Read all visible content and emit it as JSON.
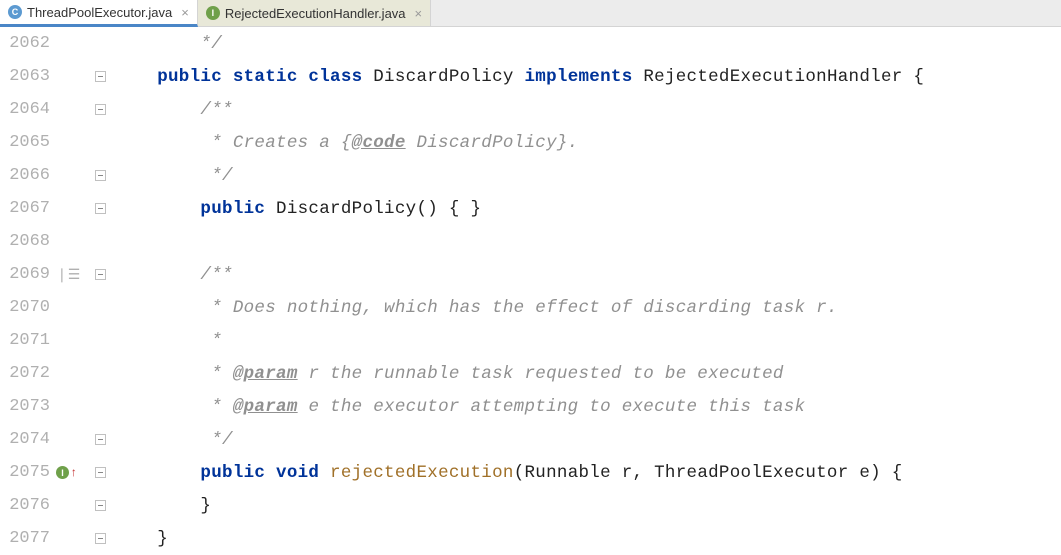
{
  "tabs": [
    {
      "label": "ThreadPoolExecutor.java",
      "icon_kind": "class",
      "icon_letter": "C",
      "active": true
    },
    {
      "label": "RejectedExecutionHandler.java",
      "icon_kind": "iface",
      "icon_letter": "I",
      "active": false
    }
  ],
  "lines": [
    {
      "no": "2062",
      "marker": "",
      "fold": "line",
      "tokens": [
        {
          "cls": "comment",
          "txt": "        */"
        }
      ]
    },
    {
      "no": "2063",
      "marker": "",
      "fold": "handle",
      "tokens": [
        {
          "cls": "kw",
          "txt": "    public static class "
        },
        {
          "cls": "plain",
          "txt": "DiscardPolicy "
        },
        {
          "cls": "kw",
          "txt": "implements "
        },
        {
          "cls": "plain",
          "txt": "RejectedExecutionHandler {"
        }
      ]
    },
    {
      "no": "2064",
      "marker": "",
      "fold": "handle",
      "tokens": [
        {
          "cls": "comment",
          "txt": "        /**"
        }
      ]
    },
    {
      "no": "2065",
      "marker": "",
      "fold": "line",
      "tokens": [
        {
          "cls": "comment",
          "txt": "         * Creates a {"
        },
        {
          "cls": "doctag",
          "txt": "@code"
        },
        {
          "cls": "comment",
          "txt": " DiscardPolicy}."
        }
      ]
    },
    {
      "no": "2066",
      "marker": "",
      "fold": "handle",
      "tokens": [
        {
          "cls": "comment",
          "txt": "         */"
        }
      ]
    },
    {
      "no": "2067",
      "marker": "",
      "fold": "handle",
      "tokens": [
        {
          "cls": "kw",
          "txt": "        public "
        },
        {
          "cls": "plain",
          "txt": "DiscardPolicy() { }"
        }
      ]
    },
    {
      "no": "2068",
      "marker": "",
      "fold": "line",
      "tokens": [
        {
          "cls": "plain",
          "txt": ""
        }
      ]
    },
    {
      "no": "2069",
      "marker": "blockcomment",
      "fold": "handle",
      "tokens": [
        {
          "cls": "comment",
          "txt": "        /**"
        }
      ]
    },
    {
      "no": "2070",
      "marker": "",
      "fold": "line",
      "tokens": [
        {
          "cls": "comment",
          "txt": "         * Does nothing, which has the effect of discarding task r."
        }
      ]
    },
    {
      "no": "2071",
      "marker": "",
      "fold": "line",
      "tokens": [
        {
          "cls": "comment",
          "txt": "         *"
        }
      ]
    },
    {
      "no": "2072",
      "marker": "",
      "fold": "line",
      "tokens": [
        {
          "cls": "comment",
          "txt": "         * "
        },
        {
          "cls": "doctag",
          "txt": "@param"
        },
        {
          "cls": "comment",
          "txt": " r the runnable task requested to be executed"
        }
      ]
    },
    {
      "no": "2073",
      "marker": "",
      "fold": "line",
      "tokens": [
        {
          "cls": "comment",
          "txt": "         * "
        },
        {
          "cls": "doctag",
          "txt": "@param"
        },
        {
          "cls": "comment",
          "txt": " e the executor attempting to execute this task"
        }
      ]
    },
    {
      "no": "2074",
      "marker": "",
      "fold": "handle",
      "tokens": [
        {
          "cls": "comment",
          "txt": "         */"
        }
      ]
    },
    {
      "no": "2075",
      "marker": "override",
      "fold": "handle",
      "tokens": [
        {
          "cls": "kw",
          "txt": "        public void "
        },
        {
          "cls": "methdecl",
          "txt": "rejectedExecution"
        },
        {
          "cls": "plain",
          "txt": "(Runnable r, ThreadPoolExecutor e) {"
        }
      ]
    },
    {
      "no": "2076",
      "marker": "",
      "fold": "handle",
      "tokens": [
        {
          "cls": "plain",
          "txt": "        }"
        }
      ]
    },
    {
      "no": "2077",
      "marker": "",
      "fold": "handle",
      "tokens": [
        {
          "cls": "plain",
          "txt": "    }"
        }
      ]
    }
  ],
  "icons": {
    "override_letter": "I",
    "up_arrow": "↑",
    "close": "×",
    "block_comment": "❘☰"
  }
}
